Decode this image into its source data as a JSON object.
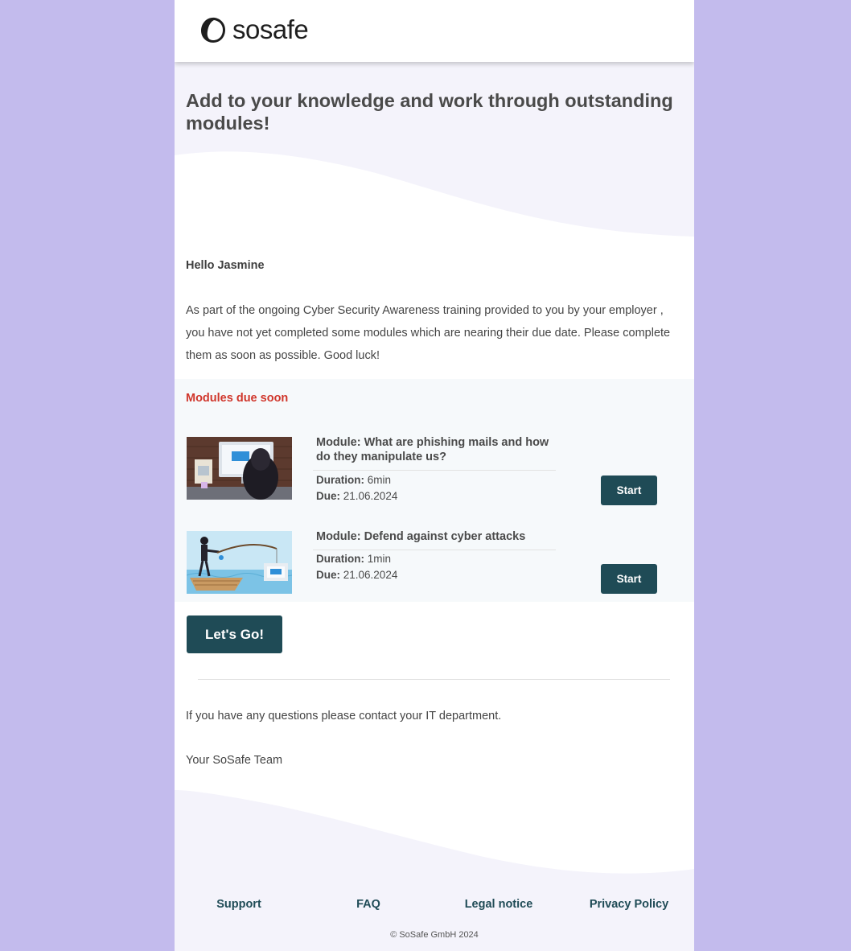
{
  "header": {
    "logo_text": "sosafe",
    "logo_icon": "sosafe-ring-icon"
  },
  "hero": {
    "title": "Add to your knowledge and work through outstanding modules!"
  },
  "greeting": "Hello Jasmine",
  "intro": "As part of the ongoing Cyber Security Awareness training provided to you by your employer , you have not yet completed some modules which are nearing their due date. Please complete them as soon as possible. Good luck!",
  "modules": {
    "heading": "Modules due soon",
    "items": [
      {
        "title": "Module: What are phishing mails and how do they manipulate us?",
        "duration_label": "Duration:",
        "duration": "6min",
        "due_label": "Due:",
        "due": "21.06.2024",
        "button": "Start",
        "thumbnail": "hacker-at-computer-illustration"
      },
      {
        "title": "Module: Defend against cyber attacks",
        "duration_label": "Duration:",
        "duration": "1min",
        "due_label": "Due:",
        "due": "21.06.2024",
        "button": "Start",
        "thumbnail": "phishing-fisherman-illustration"
      }
    ]
  },
  "cta": {
    "label": "Let's Go!"
  },
  "questions": "If you have any questions please contact your IT department.",
  "signoff": "Your SoSafe Team",
  "footer": {
    "links": [
      "Support",
      "FAQ",
      "Legal notice",
      "Privacy Policy"
    ],
    "copyright": "© SoSafe GmbH 2024"
  },
  "colors": {
    "page_background": "#c3bbed",
    "accent_dark_teal": "#1f4b56",
    "heading_red": "#d0362b",
    "soft_lavender": "#f4f3fb"
  }
}
